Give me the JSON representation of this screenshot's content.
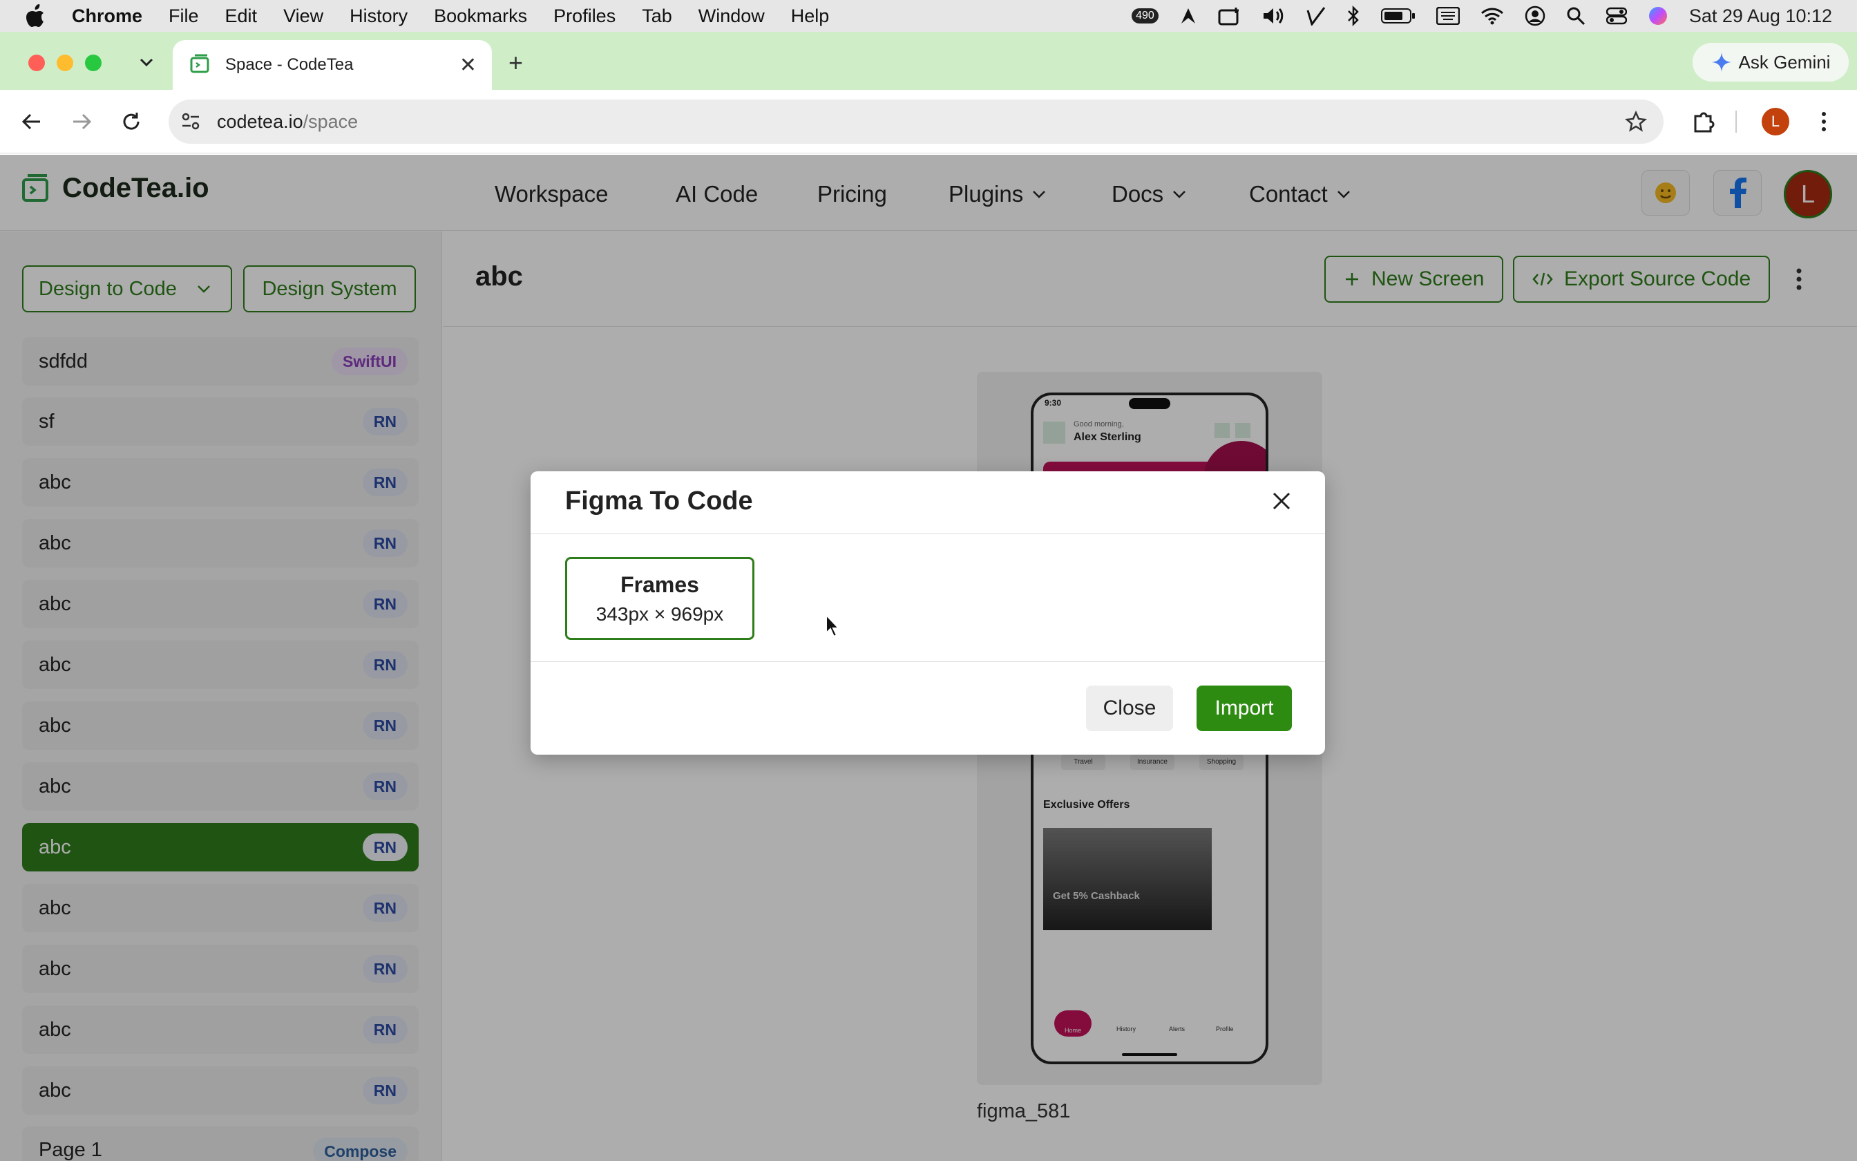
{
  "menubar": {
    "app": "Chrome",
    "items": [
      "File",
      "Edit",
      "View",
      "History",
      "Bookmarks",
      "Profiles",
      "Tab",
      "Window",
      "Help"
    ],
    "badge": "490",
    "datetime": "Sat 29 Aug  10:12"
  },
  "browser": {
    "tab_title": "Space - CodeTea",
    "ask_gemini": "Ask Gemini",
    "url_host": "codetea.io",
    "url_path": "/space",
    "profile_initial": "L"
  },
  "site": {
    "logo": "CodeTea.io",
    "nav": [
      "Workspace",
      "AI Code",
      "Pricing",
      "Plugins",
      "Docs",
      "Contact"
    ],
    "avatar_initial": "L"
  },
  "sidebar": {
    "dropdown_label": "Design to Code",
    "design_system_label": "Design System",
    "items": [
      {
        "name": "sdfdd",
        "tag": "SwiftUI"
      },
      {
        "name": "sf",
        "tag": "RN"
      },
      {
        "name": "abc",
        "tag": "RN"
      },
      {
        "name": "abc",
        "tag": "RN"
      },
      {
        "name": "abc",
        "tag": "RN"
      },
      {
        "name": "abc",
        "tag": "RN"
      },
      {
        "name": "abc",
        "tag": "RN"
      },
      {
        "name": "abc",
        "tag": "RN"
      },
      {
        "name": "abc",
        "tag": "RN"
      },
      {
        "name": "abc",
        "tag": "RN"
      },
      {
        "name": "abc",
        "tag": "RN"
      },
      {
        "name": "abc",
        "tag": "RN"
      },
      {
        "name": "abc",
        "tag": "RN"
      },
      {
        "name": "Page 1",
        "tag": "Compose"
      }
    ]
  },
  "main": {
    "title": "abc",
    "new_screen": "New Screen",
    "export": "Export Source Code",
    "preview_caption": "figma_581",
    "phone": {
      "time": "9:30",
      "greeting": "Good morning,",
      "user": "Alex Sterling",
      "categories": [
        "Travel",
        "Insurance",
        "Shopping"
      ],
      "offers_title": "Exclusive Offers",
      "offer_text": "Get 5% Cashback",
      "nav": [
        "Home",
        "History",
        "Alerts",
        "Profile"
      ]
    }
  },
  "modal": {
    "title": "Figma To Code",
    "frame_name": "Frames",
    "frame_size": "343px × 969px",
    "close_label": "Close",
    "import_label": "Import"
  },
  "colors": {
    "brand_green": "#2e7d1b",
    "import_green": "#2e8b12",
    "tab_strip": "#cfeec8"
  }
}
